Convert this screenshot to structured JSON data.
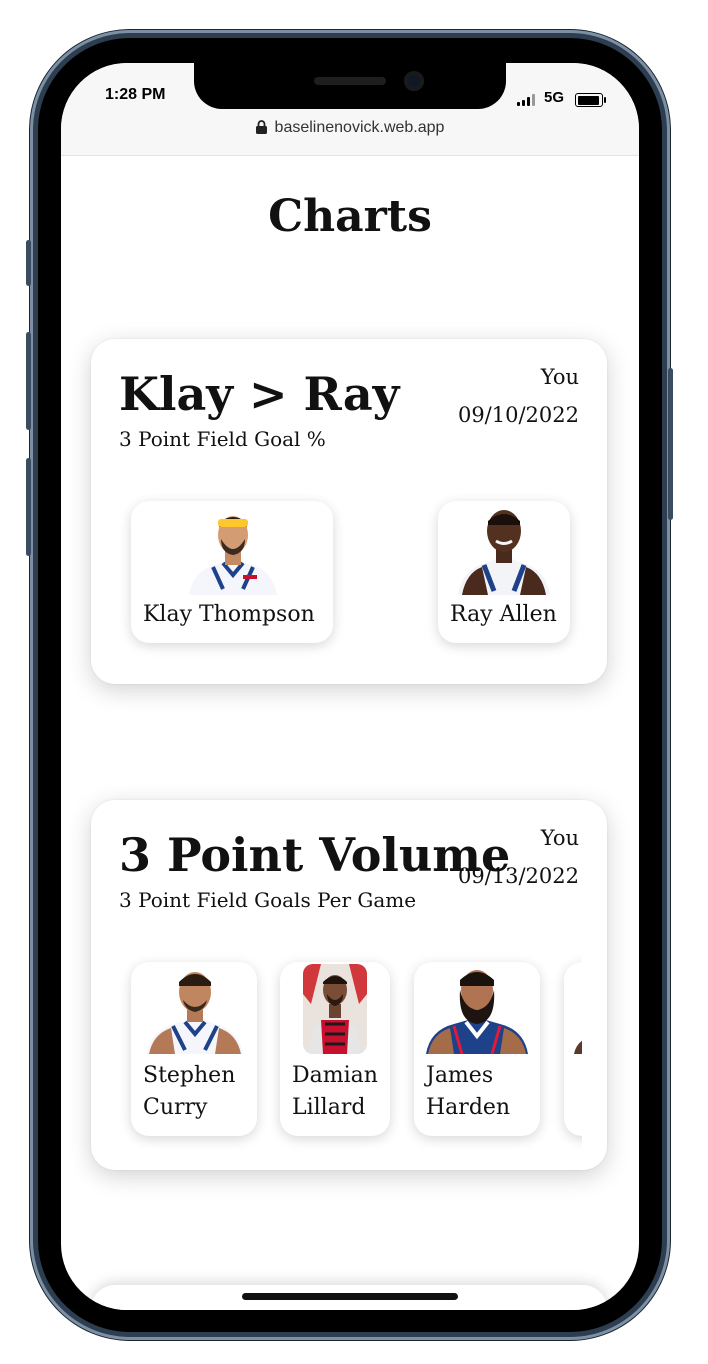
{
  "status": {
    "time": "1:28 PM",
    "network": "5G"
  },
  "browser": {
    "url": "baselinenovick.web.app"
  },
  "page": {
    "title": "Charts"
  },
  "cards": [
    {
      "title": "Klay > Ray",
      "subtitle": "3 Point Field Goal %",
      "author": "You",
      "date": "09/10/2022",
      "players": [
        {
          "name": "Klay Thompson"
        },
        {
          "name": "Ray Allen"
        }
      ]
    },
    {
      "title": "3 Point Volume",
      "subtitle": "3 Point Field Goals Per Game",
      "author": "You",
      "date": "09/13/2022",
      "players": [
        {
          "name": "Stephen Curry"
        },
        {
          "name": "Damian Lillard"
        },
        {
          "name": "James Harden"
        }
      ]
    }
  ]
}
